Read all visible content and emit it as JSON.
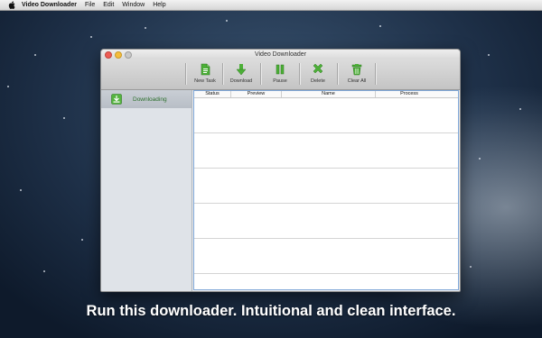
{
  "menubar": {
    "app_name": "Video Downloader",
    "items": [
      "File",
      "Edit",
      "Window",
      "Help"
    ]
  },
  "window": {
    "title": "Video Downloader"
  },
  "toolbar": {
    "buttons": [
      {
        "label": "New Task",
        "icon": "new-task-icon"
      },
      {
        "label": "Download",
        "icon": "download-icon"
      },
      {
        "label": "Pause",
        "icon": "pause-icon"
      },
      {
        "label": "Delete",
        "icon": "delete-icon"
      },
      {
        "label": "Clear All",
        "icon": "clear-all-icon"
      }
    ]
  },
  "sidebar": {
    "items": [
      {
        "label": "Downloading",
        "icon": "download-tray-icon",
        "selected": true
      }
    ]
  },
  "table": {
    "columns": [
      "Status",
      "Preview",
      "Name",
      "Process"
    ],
    "rows": []
  },
  "caption": "Run this downloader. Intuitional and clean interface.",
  "colors": {
    "accent_green": "#3f9a2e",
    "selection_blue": "#7fa7d8"
  }
}
